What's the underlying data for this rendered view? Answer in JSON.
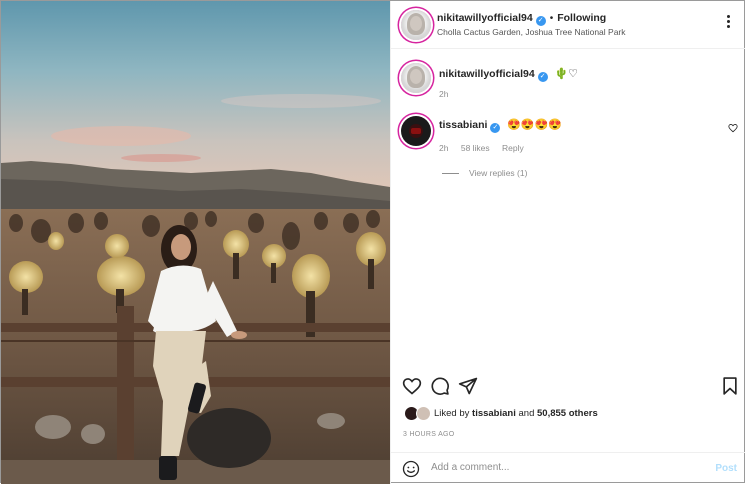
{
  "post": {
    "author": "nikitawillyofficial94",
    "follow_status": "Following",
    "location": "Cholla Cactus Garden, Joshua Tree National Park"
  },
  "caption": {
    "author": "nikitawillyofficial94",
    "emojis": "🌵♡",
    "time": "2h"
  },
  "comments": [
    {
      "author": "tissabiani",
      "text": "😍😍😍😍",
      "time": "2h",
      "likes": "58 likes",
      "reply_label": "Reply",
      "view_replies": "View replies (1)"
    }
  ],
  "likes": {
    "prefix": "Liked by",
    "user": "tissabiani",
    "joiner": "and",
    "others": "50,855 others"
  },
  "timestamp": "3 HOURS AGO",
  "comment_box": {
    "placeholder": "Add a comment...",
    "post_label": "Post"
  },
  "icons": {
    "more": "more-options-icon",
    "like": "heart-icon",
    "comment": "comment-bubble-icon",
    "share": "paper-plane-icon",
    "save": "bookmark-icon",
    "emoji": "smiley-icon",
    "verified": "verified-badge-icon"
  },
  "colors": {
    "verified": "#3897f0",
    "post_button_disabled": "#b2dffc",
    "story_ring": "#d6249f"
  }
}
